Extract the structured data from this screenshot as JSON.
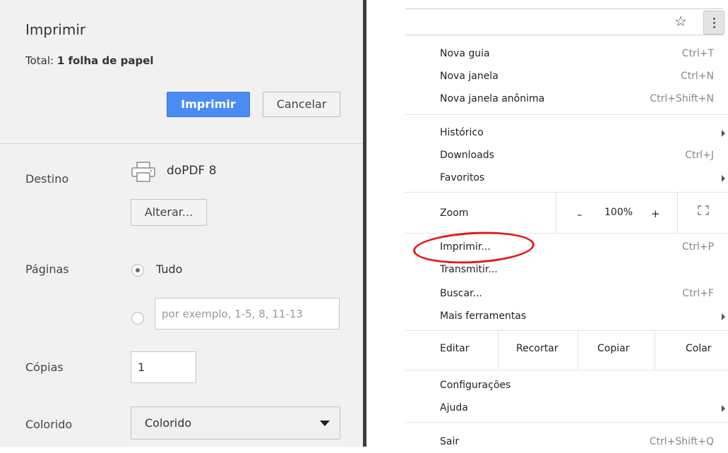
{
  "print_dialog": {
    "title": "Imprimir",
    "total_label": "Total:",
    "total_value": "1 folha de papel",
    "print_button": "Imprimir",
    "cancel_button": "Cancelar",
    "destination": {
      "label": "Destino",
      "printer_name": "doPDF 8",
      "change_button": "Alterar...",
      "icon": "printer-icon"
    },
    "pages": {
      "label": "Páginas",
      "option_all": "Tudo",
      "option_all_selected": true,
      "range_placeholder": "por exemplo, 1-5, 8, 11-13"
    },
    "copies": {
      "label": "Cópias",
      "value": "1"
    },
    "color": {
      "label": "Colorido",
      "selected": "Colorido"
    }
  },
  "chrome_menu": {
    "star_icon": "star-icon",
    "menu_icon": "more-vert-icon",
    "items": [
      {
        "label": "Nova guia",
        "shortcut": "Ctrl+T"
      },
      {
        "label": "Nova janela",
        "shortcut": "Ctrl+N"
      },
      {
        "label": "Nova janela anônima",
        "shortcut": "Ctrl+Shift+N"
      },
      {
        "label": "Histórico",
        "submenu": true
      },
      {
        "label": "Downloads",
        "shortcut": "Ctrl+J"
      },
      {
        "label": "Favoritos",
        "submenu": true
      },
      {
        "label": "Imprimir...",
        "shortcut": "Ctrl+P"
      },
      {
        "label": "Transmitir..."
      },
      {
        "label": "Buscar...",
        "shortcut": "Ctrl+F"
      },
      {
        "label": "Mais ferramentas",
        "submenu": true
      },
      {
        "label": "Configurações"
      },
      {
        "label": "Ajuda",
        "submenu": true
      },
      {
        "label": "Sair",
        "shortcut": "Ctrl+Shift+Q"
      }
    ],
    "zoom": {
      "label": "Zoom",
      "minus": "–",
      "value": "100%",
      "plus": "+"
    },
    "edit": {
      "label": "Editar",
      "cut": "Recortar",
      "copy": "Copiar",
      "paste": "Colar"
    },
    "annotation_color": "#e11919"
  }
}
